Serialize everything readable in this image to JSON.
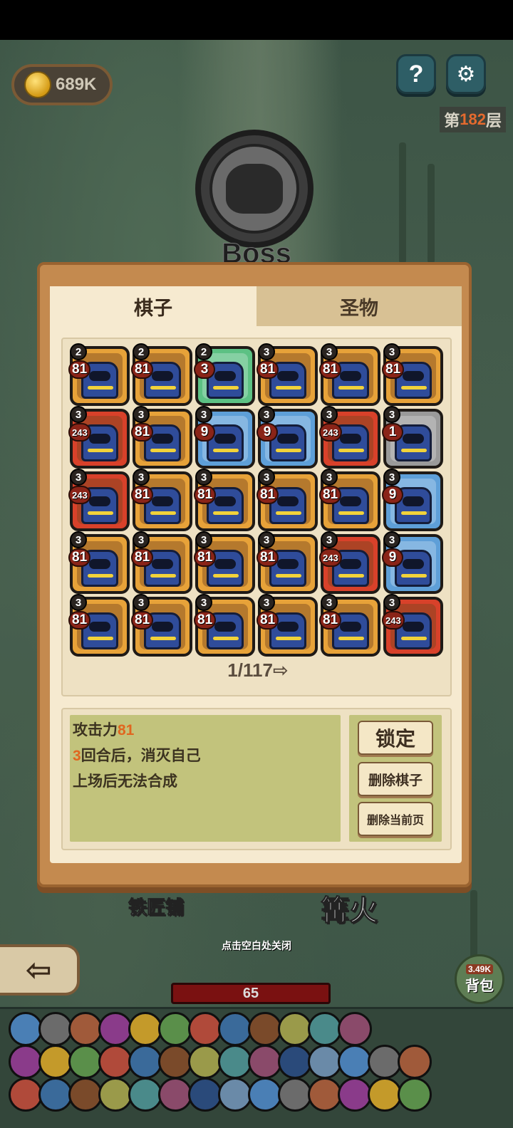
{
  "hud": {
    "coins": "689K",
    "help_label": "?",
    "settings_label": "⚙",
    "floor_prefix": "第",
    "floor_number": "182",
    "floor_suffix": "层"
  },
  "boss": {
    "label": "Boss"
  },
  "modal": {
    "tabs": [
      {
        "label": "棋子"
      },
      {
        "label": "圣物"
      }
    ],
    "pieces": [
      {
        "turns": "2",
        "atk": "81",
        "color": "gold"
      },
      {
        "turns": "2",
        "atk": "81",
        "color": "gold"
      },
      {
        "turns": "2",
        "atk": "3",
        "color": "green"
      },
      {
        "turns": "3",
        "atk": "81",
        "color": "gold"
      },
      {
        "turns": "3",
        "atk": "81",
        "color": "gold"
      },
      {
        "turns": "3",
        "atk": "81",
        "color": "gold"
      },
      {
        "turns": "3",
        "atk": "243",
        "color": "red"
      },
      {
        "turns": "3",
        "atk": "81",
        "color": "gold"
      },
      {
        "turns": "3",
        "atk": "9",
        "color": "blue"
      },
      {
        "turns": "3",
        "atk": "9",
        "color": "blue"
      },
      {
        "turns": "3",
        "atk": "243",
        "color": "red"
      },
      {
        "turns": "3",
        "atk": "1",
        "color": "gray"
      },
      {
        "turns": "3",
        "atk": "243",
        "color": "red"
      },
      {
        "turns": "3",
        "atk": "81",
        "color": "gold"
      },
      {
        "turns": "3",
        "atk": "81",
        "color": "gold"
      },
      {
        "turns": "3",
        "atk": "81",
        "color": "gold"
      },
      {
        "turns": "3",
        "atk": "81",
        "color": "gold"
      },
      {
        "turns": "3",
        "atk": "9",
        "color": "blue"
      },
      {
        "turns": "3",
        "atk": "81",
        "color": "gold"
      },
      {
        "turns": "3",
        "atk": "81",
        "color": "gold"
      },
      {
        "turns": "3",
        "atk": "81",
        "color": "gold"
      },
      {
        "turns": "3",
        "atk": "81",
        "color": "gold"
      },
      {
        "turns": "3",
        "atk": "243",
        "color": "red"
      },
      {
        "turns": "3",
        "atk": "9",
        "color": "blue"
      },
      {
        "turns": "3",
        "atk": "81",
        "color": "gold"
      },
      {
        "turns": "3",
        "atk": "81",
        "color": "gold"
      },
      {
        "turns": "3",
        "atk": "81",
        "color": "gold"
      },
      {
        "turns": "3",
        "atk": "81",
        "color": "gold"
      },
      {
        "turns": "3",
        "atk": "81",
        "color": "gold"
      },
      {
        "turns": "3",
        "atk": "243",
        "color": "red"
      }
    ],
    "pager": {
      "text": "1/117",
      "next_icon": "⇨"
    },
    "desc": {
      "line1_prefix": "攻击力",
      "line1_value": "81",
      "line2_value": "3",
      "line2_suffix": "回合后，消灭自己",
      "line3": "上场后无法合成"
    },
    "buttons": {
      "lock": "锁定",
      "delete_piece": "删除棋子",
      "delete_page": "删除当前页"
    }
  },
  "map": {
    "smithy": "铁匠铺",
    "campfire": "篝火",
    "close_hint": "点击空白处关闭",
    "back_icon": "⇦",
    "hp": "65",
    "bag_value": "3.49K",
    "bag_label": "背包"
  },
  "colors": {
    "gold": "#e7a239",
    "red": "#d8412a",
    "blue": "#5e9fd8",
    "green": "#5cc184",
    "gray": "#9a9a9a",
    "highlight": "#e0661f"
  }
}
